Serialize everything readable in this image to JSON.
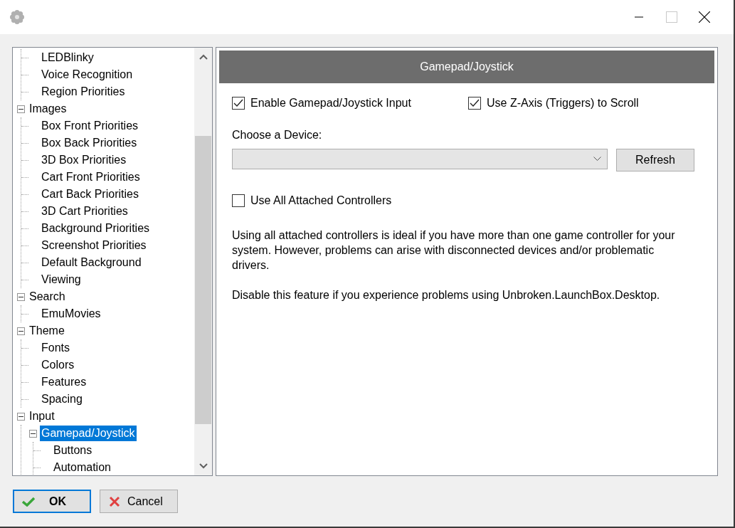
{
  "title_bar": {
    "maximize_disabled": true
  },
  "tree": {
    "items": [
      {
        "children": [
          {
            "label": "LEDBlinky",
            "selected": false
          },
          {
            "label": "Voice Recognition",
            "selected": false
          },
          {
            "label": "Region Priorities",
            "selected": false
          }
        ]
      },
      {
        "label": "Images",
        "selected": false,
        "expanded": true,
        "children": [
          {
            "label": "Box Front Priorities",
            "selected": false
          },
          {
            "label": "Box Back Priorities",
            "selected": false
          },
          {
            "label": "3D Box Priorities",
            "selected": false
          },
          {
            "label": "Cart Front Priorities",
            "selected": false
          },
          {
            "label": "Cart Back Priorities",
            "selected": false
          },
          {
            "label": "3D Cart Priorities",
            "selected": false
          },
          {
            "label": "Background Priorities",
            "selected": false
          },
          {
            "label": "Screenshot Priorities",
            "selected": false
          },
          {
            "label": "Default Background",
            "selected": false
          },
          {
            "label": "Viewing",
            "selected": false
          }
        ]
      },
      {
        "label": "Search",
        "selected": false,
        "expanded": true,
        "children": [
          {
            "label": "EmuMovies",
            "selected": false
          }
        ]
      },
      {
        "label": "Theme",
        "selected": false,
        "expanded": true,
        "children": [
          {
            "label": "Fonts",
            "selected": false
          },
          {
            "label": "Colors",
            "selected": false
          },
          {
            "label": "Features",
            "selected": false
          },
          {
            "label": "Spacing",
            "selected": false
          }
        ]
      },
      {
        "label": "Input",
        "selected": false,
        "expanded": true,
        "children": [
          {
            "label": "Gamepad/Joystick",
            "selected": true,
            "expanded": true,
            "children": [
              {
                "label": "Buttons",
                "selected": false
              },
              {
                "label": "Automation",
                "selected": false
              }
            ]
          }
        ]
      }
    ]
  },
  "panel": {
    "title": "Gamepad/Joystick",
    "options": [
      {
        "label": "Enable Gamepad/Joystick Input",
        "checked": true
      },
      {
        "label": "Use Z-Axis (Triggers) to Scroll",
        "checked": true
      }
    ],
    "device_label": "Choose a Device:",
    "refresh_button": "Refresh",
    "all_controllers": {
      "label": "Use All Attached Controllers",
      "checked": false
    },
    "paragraphs": [
      "Using all attached controllers is ideal if you have more than one game controller for your system. However, problems can arise with disconnected devices and/or problematic drivers.",
      "Disable this feature if you experience problems using Unbroken.LaunchBox.Desktop."
    ]
  },
  "buttons": [
    {
      "label": "OK",
      "kind": "ok",
      "focused": true
    },
    {
      "label": "Cancel",
      "kind": "cancel",
      "focused": false
    }
  ]
}
